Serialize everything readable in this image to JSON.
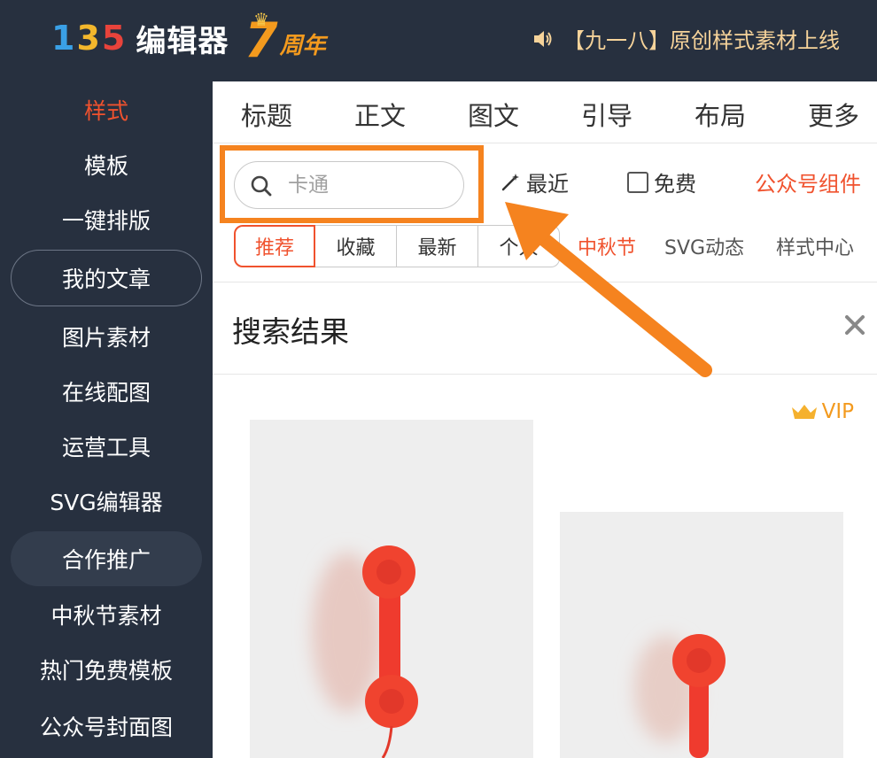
{
  "header": {
    "logo_mark": [
      "1",
      "3",
      "5"
    ],
    "logo_text": "编辑器",
    "anniversary_number": "7",
    "anniversary_text": "周年",
    "notice": "【九一八】原创样式素材上线",
    "speaker_icon": "speaker-icon"
  },
  "sidebar": {
    "items": [
      {
        "label": "样式",
        "active": true
      },
      {
        "label": "模板"
      },
      {
        "label": "一键排版"
      },
      {
        "label": "我的文章"
      },
      {
        "label": "图片素材"
      },
      {
        "label": "在线配图"
      },
      {
        "label": "运营工具"
      },
      {
        "label": "SVG编辑器"
      },
      {
        "label": "合作推广"
      },
      {
        "label": "中秋节素材"
      },
      {
        "label": "热门免费模板"
      },
      {
        "label": "公众号封面图"
      }
    ]
  },
  "tabs": [
    "标题",
    "正文",
    "图文",
    "引导",
    "布局",
    "更多"
  ],
  "toolbar": {
    "search_placeholder": "卡通",
    "recent_label": "最近",
    "free_label": "免费",
    "gzh_label": "公众号组件"
  },
  "filters": {
    "segments": [
      "推荐",
      "收藏",
      "最新",
      "个人"
    ],
    "links": [
      "中秋节",
      "SVG动态",
      "样式中心"
    ]
  },
  "results": {
    "title": "搜索结果",
    "vip_label": "VIP"
  },
  "colors": {
    "header_bg": "#27303f",
    "accent": "#f0522e",
    "annotation": "#f5831f"
  }
}
